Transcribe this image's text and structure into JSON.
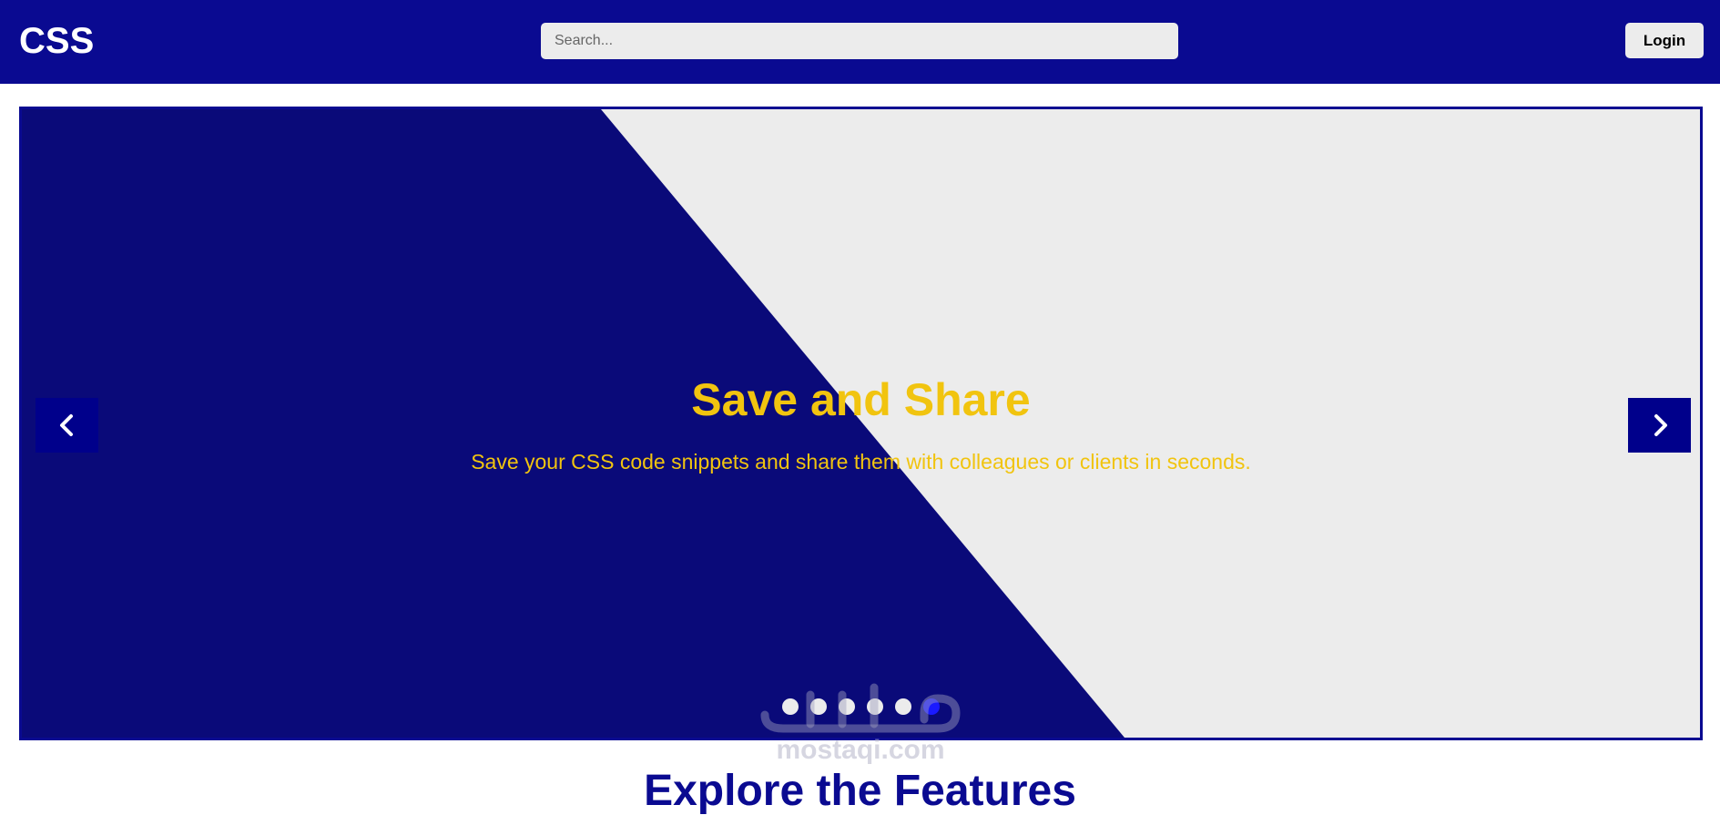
{
  "header": {
    "logo": "CSS",
    "search_placeholder": "Search...",
    "login_label": "Login"
  },
  "slider": {
    "title": "Save and Share",
    "text": "Save your CSS code snippets and share them with colleagues or clients in seconds.",
    "dots": 6,
    "active_dot": 6,
    "prev_icon": "chevron-left-icon",
    "next_icon": "chevron-right-icon"
  },
  "watermark": {
    "text": "mostaqi.com"
  },
  "section": {
    "title": "Explore the Features"
  },
  "colors": {
    "primary": "#0a0a91",
    "accent": "#f1c40f",
    "light": "#ececec",
    "arrow_bg": "#00008b",
    "active_dot": "#1a1aff"
  }
}
